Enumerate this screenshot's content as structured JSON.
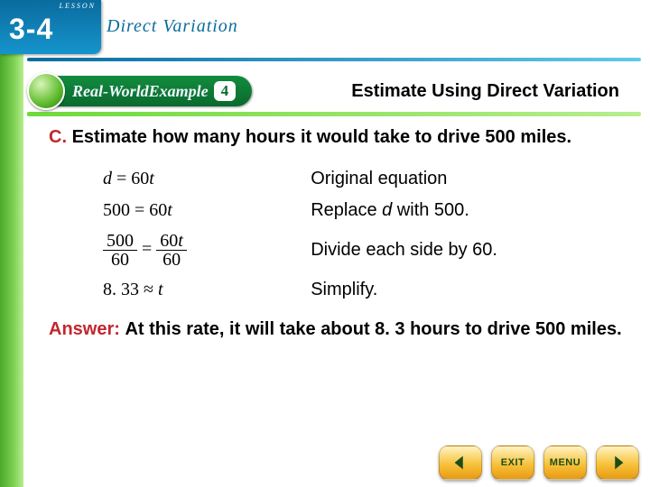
{
  "lesson": {
    "label": "LESSON",
    "number": "3-4",
    "title": "Direct Variation"
  },
  "badge": {
    "banner_prefix": "Real-World",
    "banner_word": " Example",
    "example_num": "4"
  },
  "slide_title": "Estimate Using Direct Variation",
  "prompt": {
    "letter": "C.",
    "text": "Estimate how many hours it would take to drive 500 miles."
  },
  "steps": [
    {
      "eq_html": "<span class='var'>d</span> = 60<span class='var'>t</span>",
      "desc": "Original equation"
    },
    {
      "eq_html": "500 = 60<span class='var'>t</span>",
      "desc_html": "Replace <span class='var'>d</span> with 500."
    },
    {
      "eq_html": "<span class='frac'><span class='num'>500</span><span class='den'>60</span></span> = <span class='frac'><span class='num'>60<span class='var'>t</span></span><span class='den'>60</span></span>",
      "desc": "Divide each side by 60."
    },
    {
      "eq_html": "8. 33 ≈ <span class='var'>t</span>",
      "desc": "Simplify."
    }
  ],
  "answer": {
    "label": "Answer:",
    "text": "At this rate, it will take about 8. 3 hours to drive 500 miles."
  },
  "nav": {
    "exit": "EXIT",
    "menu": "MENU"
  }
}
